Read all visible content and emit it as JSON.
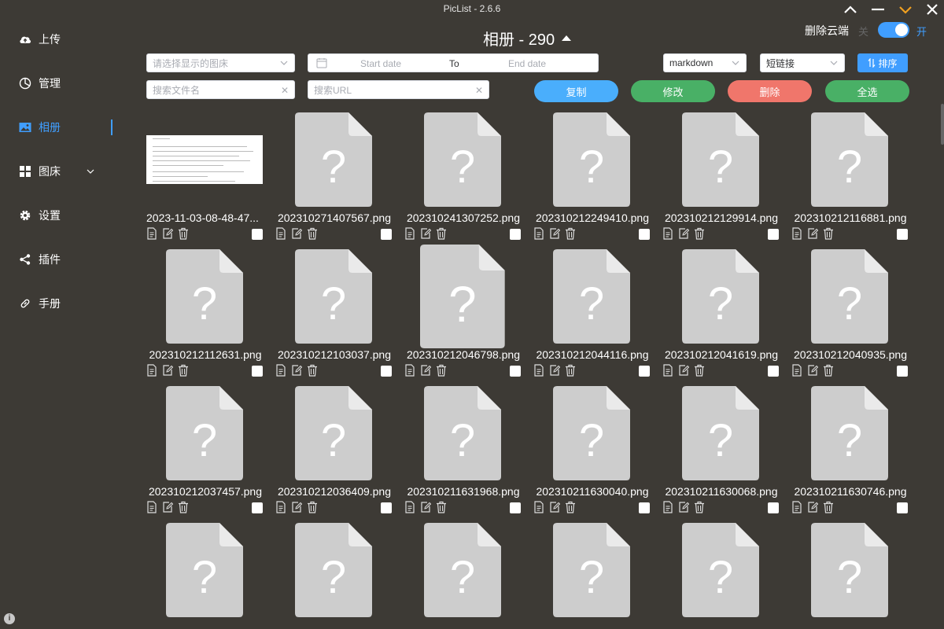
{
  "app": {
    "title": "PicList - 2.6.6"
  },
  "sidebar": {
    "items": [
      {
        "label": "上传",
        "icon": "cloud-upload-icon"
      },
      {
        "label": "管理",
        "icon": "pie-chart-icon"
      },
      {
        "label": "相册",
        "icon": "picture-icon",
        "active": true
      },
      {
        "label": "图床",
        "icon": "grid-icon"
      },
      {
        "label": "设置",
        "icon": "gear-icon"
      },
      {
        "label": "插件",
        "icon": "share-icon"
      },
      {
        "label": "手册",
        "icon": "link-icon"
      }
    ]
  },
  "gallery": {
    "title": "相册 - 290"
  },
  "cloud_delete": {
    "label": "删除云端",
    "off_label": "关",
    "on_label": "开",
    "enabled": true
  },
  "filters": {
    "bed_select_placeholder": "请选择显示的图床",
    "start_date_placeholder": "Start date",
    "date_separator": "To",
    "end_date_placeholder": "End date",
    "format_select": "markdown",
    "link_select": "短链接",
    "sort_label": "排序",
    "search_filename_placeholder": "搜索文件名",
    "search_url_placeholder": "搜索URL"
  },
  "actions": {
    "copy": "复制",
    "edit": "修改",
    "delete": "删除",
    "select_all": "全选"
  },
  "colors": {
    "accent": "#409eff",
    "copy": "#4aaefc",
    "edit": "#49b066",
    "delete": "#f0766b",
    "select_all": "#49b066",
    "background": "#3d3a35"
  },
  "images": [
    {
      "name": "2023-11-03-08-48-47...",
      "thumb": "document"
    },
    {
      "name": "202310271407567.png",
      "thumb": "unknown"
    },
    {
      "name": "202310241307252.png",
      "thumb": "unknown"
    },
    {
      "name": "202310212249410.png",
      "thumb": "unknown"
    },
    {
      "name": "202310212129914.png",
      "thumb": "unknown"
    },
    {
      "name": "202310212116881.png",
      "thumb": "unknown"
    },
    {
      "name": "202310212112631.png",
      "thumb": "unknown"
    },
    {
      "name": "202310212103037.png",
      "thumb": "unknown"
    },
    {
      "name": "202310212046798.png",
      "thumb": "unknown"
    },
    {
      "name": "202310212044116.png",
      "thumb": "unknown"
    },
    {
      "name": "202310212041619.png",
      "thumb": "unknown"
    },
    {
      "name": "202310212040935.png",
      "thumb": "unknown"
    },
    {
      "name": "202310212037457.png",
      "thumb": "unknown"
    },
    {
      "name": "202310212036409.png",
      "thumb": "unknown"
    },
    {
      "name": "202310211631968.png",
      "thumb": "unknown"
    },
    {
      "name": "202310211630040.png",
      "thumb": "unknown"
    },
    {
      "name": "202310211630068.png",
      "thumb": "unknown"
    },
    {
      "name": "202310211630746.png",
      "thumb": "unknown"
    },
    {
      "name": "",
      "thumb": "unknown"
    },
    {
      "name": "",
      "thumb": "unknown"
    },
    {
      "name": "",
      "thumb": "unknown"
    },
    {
      "name": "",
      "thumb": "unknown"
    },
    {
      "name": "",
      "thumb": "unknown"
    },
    {
      "name": "",
      "thumb": "unknown"
    }
  ]
}
